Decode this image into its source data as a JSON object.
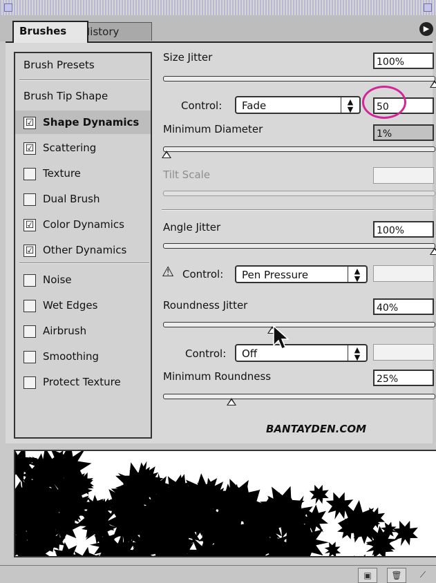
{
  "tabs": {
    "brushes": "Brushes",
    "history": "History"
  },
  "menu_icon": "panel-menu-arrow",
  "sidebar": {
    "brush_presets": "Brush Presets",
    "brush_tip_shape": "Brush Tip Shape",
    "items": [
      {
        "label": "Shape Dynamics",
        "checked": "☑"
      },
      {
        "label": "Scattering",
        "checked": "☑"
      },
      {
        "label": "Texture",
        "checked": ""
      },
      {
        "label": "Dual Brush",
        "checked": ""
      },
      {
        "label": "Color Dynamics",
        "checked": "☑"
      },
      {
        "label": "Other Dynamics",
        "checked": "☑"
      },
      {
        "label": "Noise",
        "checked": ""
      },
      {
        "label": "Wet Edges",
        "checked": ""
      },
      {
        "label": "Airbrush",
        "checked": ""
      },
      {
        "label": "Smoothing",
        "checked": ""
      },
      {
        "label": "Protect Texture",
        "checked": ""
      }
    ]
  },
  "controls": {
    "size_jitter": {
      "label": "Size Jitter",
      "value": "100%",
      "level": 1.0
    },
    "size_control": {
      "label": "Control:",
      "option": "Fade",
      "steps": "50"
    },
    "minimum_diameter": {
      "label": "Minimum Diameter",
      "value": "1%",
      "level": 0.01
    },
    "tilt_scale": {
      "label": "Tilt Scale",
      "value": ""
    },
    "angle_jitter": {
      "label": "Angle Jitter",
      "value": "100%",
      "level": 1.0
    },
    "angle_control": {
      "label": "Control:",
      "option": "Pen Pressure",
      "value": ""
    },
    "roundness_jitter": {
      "label": "Roundness Jitter",
      "value": "40%",
      "level": 0.4
    },
    "roundness_control": {
      "label": "Control:",
      "option": "Off",
      "value": ""
    },
    "minimum_roundness": {
      "label": "Minimum Roundness",
      "value": "25%",
      "level": 0.25
    }
  },
  "watermark": "BANTAYDEN.COM",
  "accent_highlight": "#d3249a",
  "status_buttons": {
    "new": "new-brush-icon",
    "trash": "trash-icon"
  }
}
